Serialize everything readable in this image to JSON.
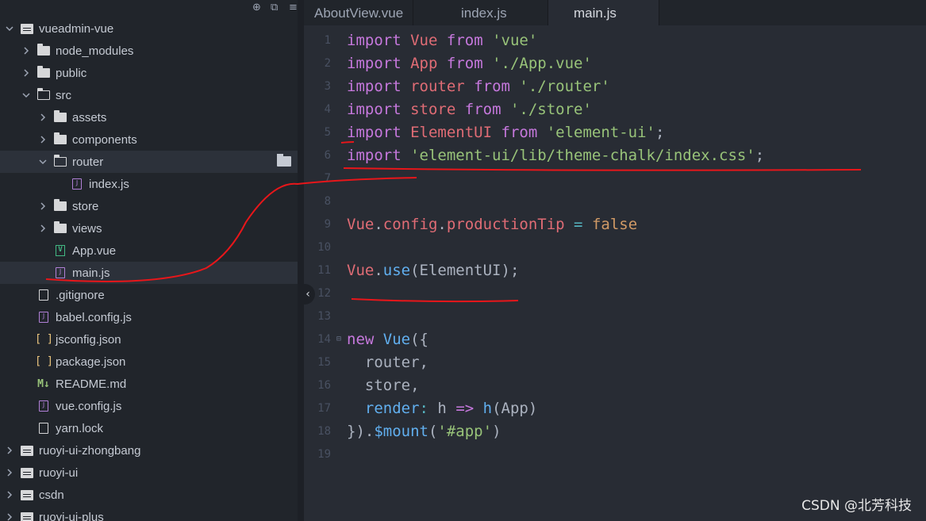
{
  "sidebar": {
    "items": [
      {
        "label": "vueadmin-vue",
        "icon": "root-folder-icon",
        "chevron": "down"
      },
      {
        "label": "node_modules",
        "icon": "folder-icon",
        "chevron": "right"
      },
      {
        "label": "public",
        "icon": "folder-icon",
        "chevron": "right"
      },
      {
        "label": "src",
        "icon": "folder-open-icon",
        "chevron": "down"
      },
      {
        "label": "assets",
        "icon": "folder-icon",
        "chevron": "right"
      },
      {
        "label": "components",
        "icon": "folder-icon",
        "chevron": "right"
      },
      {
        "label": "router",
        "icon": "folder-open-icon",
        "chevron": "down"
      },
      {
        "label": "index.js",
        "icon": "js-file-icon"
      },
      {
        "label": "store",
        "icon": "folder-icon",
        "chevron": "right"
      },
      {
        "label": "views",
        "icon": "folder-icon",
        "chevron": "right"
      },
      {
        "label": "App.vue",
        "icon": "vue-file-icon"
      },
      {
        "label": "main.js",
        "icon": "js-file-icon"
      },
      {
        "label": ".gitignore",
        "icon": "file-icon"
      },
      {
        "label": "babel.config.js",
        "icon": "js-file-icon"
      },
      {
        "label": "jsconfig.json",
        "icon": "json-file-icon"
      },
      {
        "label": "package.json",
        "icon": "json-file-icon"
      },
      {
        "label": "README.md",
        "icon": "markdown-file-icon"
      },
      {
        "label": "vue.config.js",
        "icon": "js-file-icon"
      },
      {
        "label": "yarn.lock",
        "icon": "file-icon"
      },
      {
        "label": "ruoyi-ui-zhongbang",
        "icon": "root-folder-icon",
        "chevron": "right"
      },
      {
        "label": "ruoyi-ui",
        "icon": "root-folder-icon",
        "chevron": "right"
      },
      {
        "label": "csdn",
        "icon": "root-folder-icon",
        "chevron": "right"
      },
      {
        "label": "ruoyi-ui-plus",
        "icon": "root-folder-icon",
        "chevron": "right"
      }
    ],
    "glyphs": {
      "js": "J",
      "vue": "V",
      "json": "[ ]",
      "md": "M↓"
    }
  },
  "tabs": [
    {
      "label": "AboutView.vue"
    },
    {
      "label": "index.js"
    },
    {
      "label": "main.js",
      "active": true
    }
  ],
  "editor": {
    "lines": [
      {
        "n": "1",
        "tokens": [
          [
            "kw",
            "import"
          ],
          [
            "pun",
            " "
          ],
          [
            "id",
            "Vue"
          ],
          [
            "pun",
            " "
          ],
          [
            "kw",
            "from"
          ],
          [
            "pun",
            " "
          ],
          [
            "str",
            "'vue'"
          ]
        ]
      },
      {
        "n": "2",
        "tokens": [
          [
            "kw",
            "import"
          ],
          [
            "pun",
            " "
          ],
          [
            "id",
            "App"
          ],
          [
            "pun",
            " "
          ],
          [
            "kw",
            "from"
          ],
          [
            "pun",
            " "
          ],
          [
            "str",
            "'./App.vue'"
          ]
        ]
      },
      {
        "n": "3",
        "tokens": [
          [
            "kw",
            "import"
          ],
          [
            "pun",
            " "
          ],
          [
            "id",
            "router"
          ],
          [
            "pun",
            " "
          ],
          [
            "kw",
            "from"
          ],
          [
            "pun",
            " "
          ],
          [
            "str",
            "'./router'"
          ]
        ]
      },
      {
        "n": "4",
        "tokens": [
          [
            "kw",
            "import"
          ],
          [
            "pun",
            " "
          ],
          [
            "id",
            "store"
          ],
          [
            "pun",
            " "
          ],
          [
            "kw",
            "from"
          ],
          [
            "pun",
            " "
          ],
          [
            "str",
            "'./store'"
          ]
        ]
      },
      {
        "n": "5",
        "tokens": [
          [
            "kw",
            "import"
          ],
          [
            "pun",
            " "
          ],
          [
            "id",
            "ElementUI"
          ],
          [
            "pun",
            " "
          ],
          [
            "kw",
            "from"
          ],
          [
            "pun",
            " "
          ],
          [
            "str",
            "'element-ui'"
          ],
          [
            "pun",
            ";"
          ]
        ]
      },
      {
        "n": "6",
        "tokens": [
          [
            "kw",
            "import"
          ],
          [
            "pun",
            " "
          ],
          [
            "str",
            "'element-ui/lib/theme-chalk/index.css'"
          ],
          [
            "pun",
            ";"
          ]
        ]
      },
      {
        "n": "7",
        "tokens": []
      },
      {
        "n": "8",
        "tokens": []
      },
      {
        "n": "9",
        "tokens": [
          [
            "id",
            "Vue"
          ],
          [
            "pun",
            "."
          ],
          [
            "id",
            "config"
          ],
          [
            "pun",
            "."
          ],
          [
            "id",
            "productionTip"
          ],
          [
            "pun",
            " "
          ],
          [
            "op",
            "="
          ],
          [
            "pun",
            " "
          ],
          [
            "bool",
            "false"
          ]
        ]
      },
      {
        "n": "10",
        "tokens": []
      },
      {
        "n": "11",
        "tokens": [
          [
            "id",
            "Vue"
          ],
          [
            "pun",
            "."
          ],
          [
            "fn",
            "use"
          ],
          [
            "pun",
            "(ElementUI);"
          ]
        ]
      },
      {
        "n": "12",
        "tokens": []
      },
      {
        "n": "13",
        "tokens": []
      },
      {
        "n": "14",
        "fold": "⊟",
        "tokens": [
          [
            "kw",
            "new"
          ],
          [
            "pun",
            " "
          ],
          [
            "fn",
            "Vue"
          ],
          [
            "pun",
            "({"
          ]
        ]
      },
      {
        "n": "15",
        "tokens": [
          [
            "pun",
            "  router,"
          ]
        ]
      },
      {
        "n": "16",
        "tokens": [
          [
            "pun",
            "  store,"
          ]
        ]
      },
      {
        "n": "17",
        "tokens": [
          [
            "pun",
            "  "
          ],
          [
            "fn",
            "render"
          ],
          [
            "op",
            ":"
          ],
          [
            "pun",
            " h "
          ],
          [
            "kw",
            "=>"
          ],
          [
            "pun",
            " "
          ],
          [
            "fn",
            "h"
          ],
          [
            "pun",
            "(App)"
          ]
        ]
      },
      {
        "n": "18",
        "tokens": [
          [
            "pun",
            "})."
          ],
          [
            "fn",
            "$mount"
          ],
          [
            "pun",
            "("
          ],
          [
            "str",
            "'#app'"
          ],
          [
            "pun",
            ")"
          ]
        ]
      },
      {
        "n": "19",
        "tokens": []
      }
    ]
  },
  "watermark": "CSDN @北芳科技",
  "colors": {
    "annotation": "#e8161a",
    "bg": "#282c34",
    "sidebar": "#21252b"
  }
}
